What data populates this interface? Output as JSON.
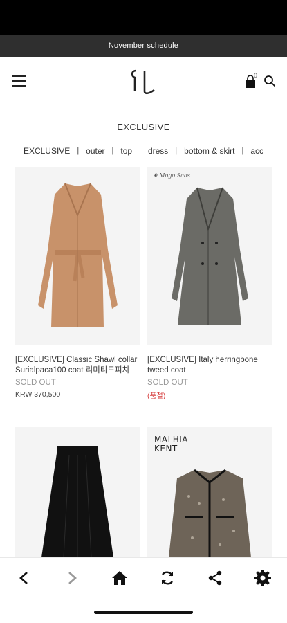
{
  "announcement": "November schedule",
  "header": {
    "cart_count": "0"
  },
  "section_title": "EXCLUSIVE",
  "categories": [
    "EXCLUSIVE",
    "outer",
    "top",
    "dress",
    "bottom & skirt",
    "acc"
  ],
  "products": [
    {
      "name": "[EXCLUSIVE] Classic Shawl collar Surialpaca100 coat 리미티드피치",
      "status": "SOLD OUT",
      "price": "KRW 370,500"
    },
    {
      "name": "[EXCLUSIVE] Italy herringbone tweed coat",
      "status": "SOLD OUT",
      "price": "(품절)"
    },
    {
      "name": "",
      "status": "",
      "price": ""
    },
    {
      "name": "",
      "status": "",
      "price": "",
      "brand_text": "MALHIA KENT"
    }
  ],
  "colors": {
    "announce_bg": "#2f2f2f",
    "sold_out_price": "#d63c3c",
    "camel_coat": "#c8926a",
    "tweed_coat": "#6b6b66"
  },
  "icons": [
    "menu-icon",
    "logo",
    "cart-icon",
    "search-icon",
    "back-icon",
    "forward-icon",
    "home-icon",
    "refresh-icon",
    "share-icon",
    "settings-icon"
  ]
}
